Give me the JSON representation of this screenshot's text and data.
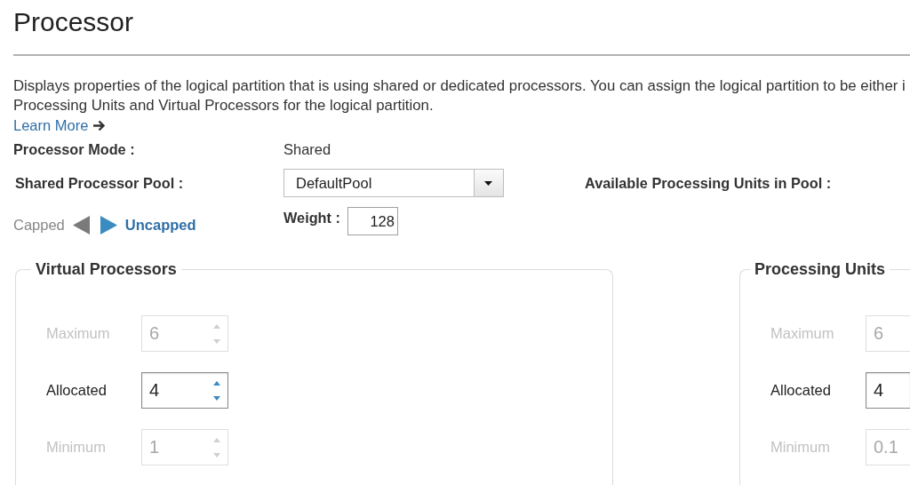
{
  "title": "Processor",
  "description": {
    "lines": [
      "Displays properties of the logical partition that is using shared or dedicated processors. You can assign the logical partition to be either i",
      "Processing Units and Virtual Processors for the logical partition."
    ],
    "link": "Learn More"
  },
  "processor_mode": {
    "label": "Processor Mode :",
    "value": "Shared"
  },
  "shared_pool": {
    "label": "Shared Processor Pool :",
    "value": "DefaultPool"
  },
  "available_units": {
    "label": "Available Processing Units in Pool :"
  },
  "capping": [
    {
      "label": "Capped",
      "selected": false
    },
    {
      "label": "Uncapped",
      "selected": true
    }
  ],
  "weight": {
    "label": "Weight :",
    "value": "128"
  },
  "panels": [
    {
      "title": "Virtual Processors",
      "rows": [
        {
          "label": "Maximum",
          "value": "6",
          "disabled": true
        },
        {
          "label": "Allocated",
          "value": "4",
          "disabled": false
        },
        {
          "label": "Minimum",
          "value": "1",
          "disabled": true
        }
      ]
    },
    {
      "title": "Processing Units",
      "rows": [
        {
          "label": "Maximum",
          "value": "6",
          "disabled": true
        },
        {
          "label": "Allocated",
          "value": "4",
          "disabled": false
        },
        {
          "label": "Minimum",
          "value": "0.1",
          "disabled": true
        }
      ]
    }
  ]
}
